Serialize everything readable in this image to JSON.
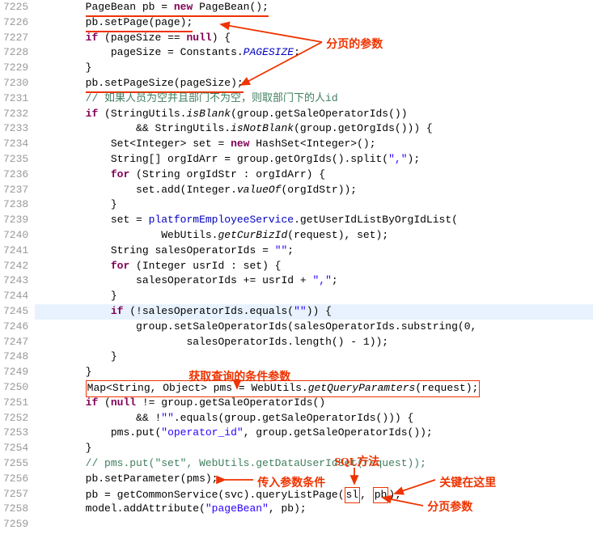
{
  "lineStart": 7225,
  "lineEnd": 7259,
  "annotations": {
    "a1": "分页的参数",
    "a2": "获取查询的条件参数",
    "a3": "SQL方法",
    "a4": "传入参数条件",
    "a5": "关键在这里",
    "a6": "分页参数"
  },
  "code": {
    "l7225_1": "PageBean pb = ",
    "l7225_new": "new",
    "l7225_2": " PageBean();",
    "l7226": "pb.setPage(page);",
    "l7227_if": "if",
    "l7227_1": " (pageSize == ",
    "l7227_null": "null",
    "l7227_2": ") {",
    "l7228_1": "pageSize = Constants.",
    "l7228_const": "PAGESIZE",
    "l7228_2": ";",
    "l7229": "}",
    "l7230_1": "pb.setPageSize(pageSize);",
    "l7231": "// 如果人员为空并且部门不为空，则取部门下的人id",
    "l7232_if": "if",
    "l7232_1": " (StringUtils.",
    "l7232_m": "isBlank",
    "l7232_2": "(group.getSaleOperatorIds())",
    "l7233_1": "&& StringUtils.",
    "l7233_m": "isNotBlank",
    "l7233_2": "(group.getOrgIds())) {",
    "l7234_1": "Set<Integer> set = ",
    "l7234_new": "new",
    "l7234_2": " HashSet<Integer>();",
    "l7235_1": "String[] orgIdArr = group.getOrgIds().split(",
    "l7235_s": "\",\"",
    "l7235_2": ");",
    "l7236_for": "for",
    "l7236_1": " (String orgIdStr : orgIdArr) {",
    "l7237_1": "set.add(Integer.",
    "l7237_m": "valueOf",
    "l7237_2": "(orgIdStr));",
    "l7238": "}",
    "l7239_1": "set = ",
    "l7239_f": "platformEmployeeService",
    "l7239_2": ".getUserIdListByOrgIdList(",
    "l7240_1": "WebUtils.",
    "l7240_m": "getCurBizId",
    "l7240_2": "(request), set);",
    "l7241_1": "String salesOperatorIds = ",
    "l7241_s": "\"\"",
    "l7241_2": ";",
    "l7242_for": "for",
    "l7242_1": " (Integer usrId : set) {",
    "l7243_1": "salesOperatorIds += usrId + ",
    "l7243_s": "\",\"",
    "l7243_2": ";",
    "l7244": "}",
    "l7245_if": "if",
    "l7245_1": " (!salesOperatorIds.equals(",
    "l7245_s": "\"\"",
    "l7245_2": ")) {",
    "l7246_1": "group.setSaleOperatorIds(salesOperatorIds.substring(0,",
    "l7247_1": "salesOperatorIds.length() - 1));",
    "l7248": "}",
    "l7249": "}",
    "l7250_1": "Map<String, Object> pms = WebUtils.",
    "l7250_m": "getQueryParamters",
    "l7250_2": "(request);",
    "l7251_if": "if",
    "l7251_1": " (",
    "l7251_null": "null",
    "l7251_2": " != group.getSaleOperatorIds()",
    "l7252_1": "&& !",
    "l7252_s": "\"\"",
    "l7252_2": ".equals(group.getSaleOperatorIds())) {",
    "l7253_1": "pms.put(",
    "l7253_s": "\"operator_id\"",
    "l7253_2": ", group.getSaleOperatorIds());",
    "l7254": "}",
    "l7255_1": "// pms.put(\"set\", WebUtils.getDataUserIdSet(request));",
    "l7256_1": "pb.setParameter(pms);",
    "l7257_1": "pb = getCommonService(svc).queryListPage(",
    "l7257_2": "sl",
    "l7257_3": ", ",
    "l7257_4": "pb",
    "l7257_5": ");",
    "l7258_1": "model.addAttribute(",
    "l7258_s": "\"pageBean\"",
    "l7258_2": ", pb);"
  }
}
